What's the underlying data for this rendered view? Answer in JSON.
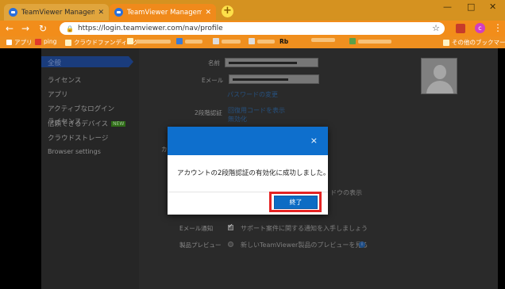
{
  "browser": {
    "tabs": [
      {
        "title": "TeamViewer Management Conso",
        "active": false
      },
      {
        "title": "TeamViewer Management Conso",
        "active": true
      }
    ],
    "new_tab": "+",
    "window_controls": [
      "—",
      "□",
      "✕"
    ],
    "nav": {
      "back": "←",
      "forward": "→",
      "reload": "↻"
    },
    "url": "https://login.teamviewer.com/nav/profile",
    "lock_glyph": "🔒",
    "bookmark_star": "☆",
    "profile_initial": "c",
    "menu_glyph": "⋮",
    "colors": {
      "titlebar": "#d59220",
      "toolbar": "#f28d1a",
      "active_tab": "#f08a1b"
    }
  },
  "bookmarks": {
    "apps": "アプリ",
    "items": [
      {
        "label": "ping"
      },
      {
        "label": "クラウドファンディング"
      }
    ],
    "other": "その他のブックマーク",
    "misc_glyph": "Rb"
  },
  "sidebar": {
    "items": [
      {
        "label": "全般",
        "active": true
      },
      {
        "label": "ライセンス"
      },
      {
        "label": "アプリ"
      },
      {
        "label": "アクティブなログイン"
      },
      {
        "label": "信頼できるデバイス",
        "badge": "NEW"
      },
      {
        "label": "クラウドストレージ"
      },
      {
        "label": "Browser settings"
      }
    ]
  },
  "profile": {
    "name_label": "名前",
    "email_label": "Eメール",
    "change_password": "パスワードの変更",
    "two_factor_label": "2段階認証",
    "recovery_code": "回復用コードを表示",
    "disable": "無効化",
    "partial_label": "カ",
    "partial_window_text": "ドウの表示",
    "email_notify_label": "Eメール通知",
    "email_notify_text": "サポート案件に関する通知を入手しましょう",
    "preview_label": "製品プレビュー",
    "preview_text": "新しいTeamViewer製品のプレビューを見る"
  },
  "modal": {
    "close": "×",
    "message": "アカウントの2段階認証の有効化に成功しました。",
    "finish_button": "終了",
    "header_color": "#0e6fcd"
  }
}
